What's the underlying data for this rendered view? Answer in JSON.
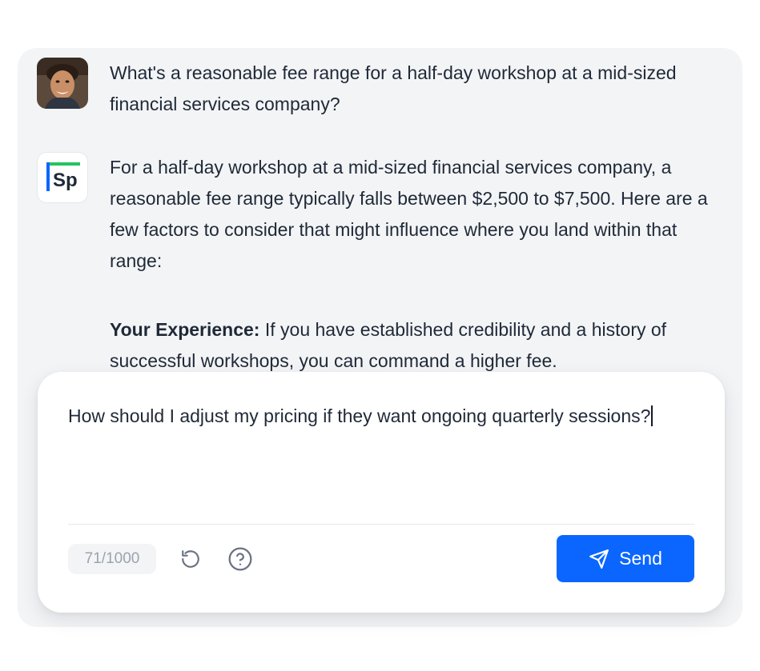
{
  "conversation": {
    "user_message": {
      "avatar_icon": "user-photo-avatar",
      "text": "What's a reasonable fee range for a half-day workshop at a mid-sized financial services company?"
    },
    "assistant_message": {
      "avatar_icon": "sp-logo",
      "avatar_text": "Sp",
      "paragraph_1": "For a half-day workshop at a mid-sized financial services company, a reasonable fee range typically falls between $2,500 to $7,500. Here are a few factors to consider that might influence where you land within that range:",
      "paragraph_2_bold": "Your Experience:",
      "paragraph_2_rest": " If you have established credibility and a history of successful workshops, you can command a higher fee."
    }
  },
  "composer": {
    "input_value": "How should I adjust my pricing if they want ongoing quarterly sessions?",
    "char_count": "71/1000",
    "reset_icon": "rotate-ccw-icon",
    "help_icon": "help-circle-icon",
    "send_icon": "send-paper-plane-icon",
    "send_label": "Send"
  },
  "colors": {
    "panel_background": "#f3f4f6",
    "accent": "#0a66ff",
    "logo_green": "#22c55e",
    "logo_blue": "#0a66ff"
  }
}
